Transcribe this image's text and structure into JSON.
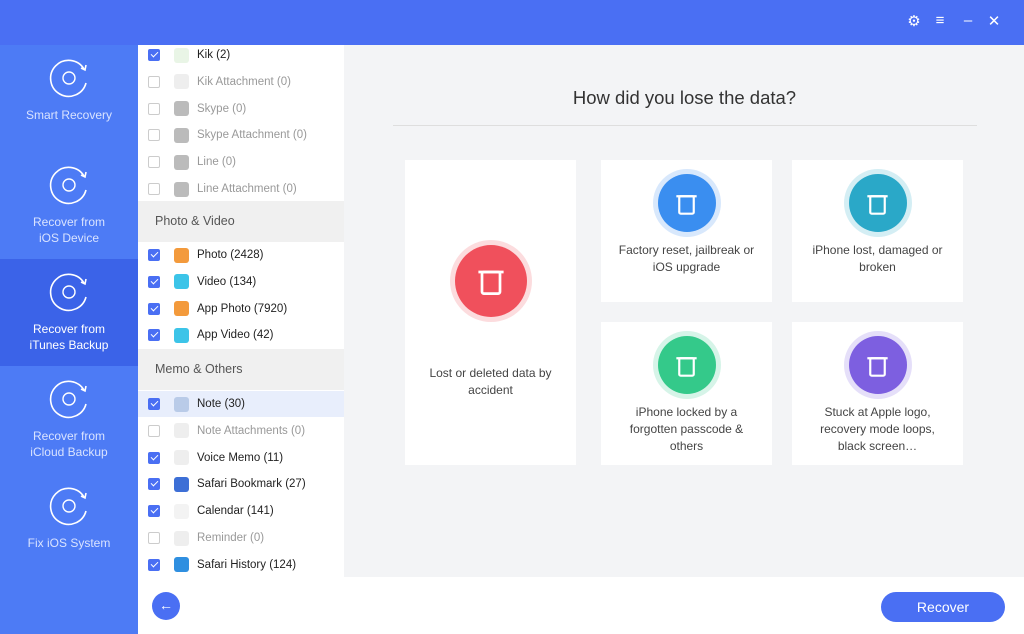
{
  "window": {
    "settings_icon": "gear-icon",
    "menu_icon": "menu-icon",
    "close_icon": "close-icon",
    "minimize_icon": "minimize-icon"
  },
  "sidebar": {
    "items": [
      {
        "label1": "Smart Recovery",
        "label2": "",
        "icon": "lightning-refresh-icon",
        "active": false
      },
      {
        "label1": "Recover from",
        "label2": "iOS Device",
        "icon": "phone-refresh-icon",
        "active": false
      },
      {
        "label1": "Recover from",
        "label2": "iTunes Backup",
        "icon": "music-refresh-icon",
        "active": true
      },
      {
        "label1": "Recover from",
        "label2": "iCloud Backup",
        "icon": "cloud-download-icon",
        "active": false
      },
      {
        "label1": "Fix iOS System",
        "label2": "",
        "icon": "wrench-icon",
        "active": false
      }
    ]
  },
  "list": {
    "group1": [
      {
        "label": "Kik (2)",
        "checked": true,
        "color": "#e9f5e6"
      },
      {
        "label": "Kik Attachment (0)",
        "checked": false,
        "color": "#eeeeee"
      },
      {
        "label": "Skype (0)",
        "checked": false,
        "color": "#bbbbbb"
      },
      {
        "label": "Skype Attachment (0)",
        "checked": false,
        "color": "#bbbbbb"
      },
      {
        "label": "Line (0)",
        "checked": false,
        "color": "#bbbbbb"
      },
      {
        "label": "Line Attachment (0)",
        "checked": false,
        "color": "#bbbbbb"
      }
    ],
    "section2": "Photo & Video",
    "group2": [
      {
        "label": "Photo (2428)",
        "checked": true,
        "color": "#f39a3c"
      },
      {
        "label": "Video (134)",
        "checked": true,
        "color": "#3cc4e8"
      },
      {
        "label": "App Photo (7920)",
        "checked": true,
        "color": "#f39a3c"
      },
      {
        "label": "App Video (42)",
        "checked": true,
        "color": "#3cc4e8"
      }
    ],
    "section3": "Memo & Others",
    "group3": [
      {
        "label": "Note (30)",
        "checked": true,
        "color": "#b9cbe8"
      },
      {
        "label": "Note Attachments (0)",
        "checked": false,
        "color": "#eeeeee"
      },
      {
        "label": "Voice Memo (11)",
        "checked": true,
        "color": "#eeeeee"
      },
      {
        "label": "Safari Bookmark (27)",
        "checked": true,
        "color": "#3d6fd6"
      },
      {
        "label": "Calendar (141)",
        "checked": true,
        "color": "#f3f3f3"
      },
      {
        "label": "Reminder (0)",
        "checked": false,
        "color": "#eeeeee"
      },
      {
        "label": "Safari History (124)",
        "checked": true,
        "color": "#2f8fe0"
      }
    ]
  },
  "main": {
    "title": "How did you lose the data?",
    "cards": [
      {
        "label": "Lost or deleted data by accident",
        "icon": "trash-icon",
        "color": "#f0505c"
      },
      {
        "label": "Factory reset, jailbreak or iOS upgrade",
        "icon": "reset-icon",
        "color": "#3a8ef0"
      },
      {
        "label": "iPhone lost, damaged or broken",
        "icon": "broken-phone-icon",
        "color": "#2aa8c8"
      },
      {
        "label": "iPhone locked by a forgotten passcode & others",
        "icon": "lock-icon",
        "color": "#34c98a"
      },
      {
        "label": "Stuck at Apple logo, recovery mode loops, black screen…",
        "icon": "apple-icon",
        "color": "#7d5fe0"
      }
    ]
  },
  "footer": {
    "back_icon": "arrow-left-icon",
    "recover": "Recover"
  }
}
